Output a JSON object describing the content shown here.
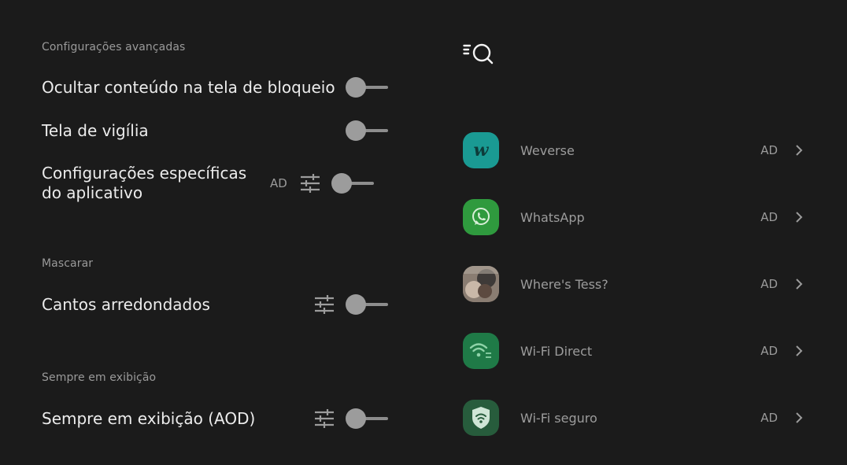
{
  "left": {
    "sections": [
      {
        "title": "Configurações avançadas"
      },
      {
        "title": "Mascarar"
      },
      {
        "title": "Sempre em exibição"
      }
    ],
    "rows": {
      "hide_lock": {
        "label": "Ocultar conteúdo na tela de bloqueio",
        "on": false
      },
      "watch_screen": {
        "label": "Tela de vigília",
        "on": false
      },
      "app_specific": {
        "label": "Configurações específicas do aplicativo",
        "badge": "AD",
        "on": false
      },
      "rounded_corners": {
        "label": "Cantos arredondados",
        "on": false
      },
      "aod": {
        "label": "Sempre em exibição (AOD)",
        "on": false
      }
    }
  },
  "right": {
    "search_icon": "search-list-icon",
    "apps": [
      {
        "name": "Weverse",
        "badge": "AD",
        "color": "#1a9a93"
      },
      {
        "name": "WhatsApp",
        "badge": "AD",
        "color": "#2f9a3e"
      },
      {
        "name": "Where's Tess?",
        "badge": "AD",
        "color": "#6a5f58"
      },
      {
        "name": "Wi-Fi Direct",
        "badge": "AD",
        "color": "#1f7a47"
      },
      {
        "name": "Wi-Fi seguro",
        "badge": "AD",
        "color": "#275c3c"
      }
    ]
  },
  "colors": {
    "background": "#1b1b1b",
    "switch_off": "#9c9c9c",
    "secondary_text": "#9a9a9a"
  }
}
